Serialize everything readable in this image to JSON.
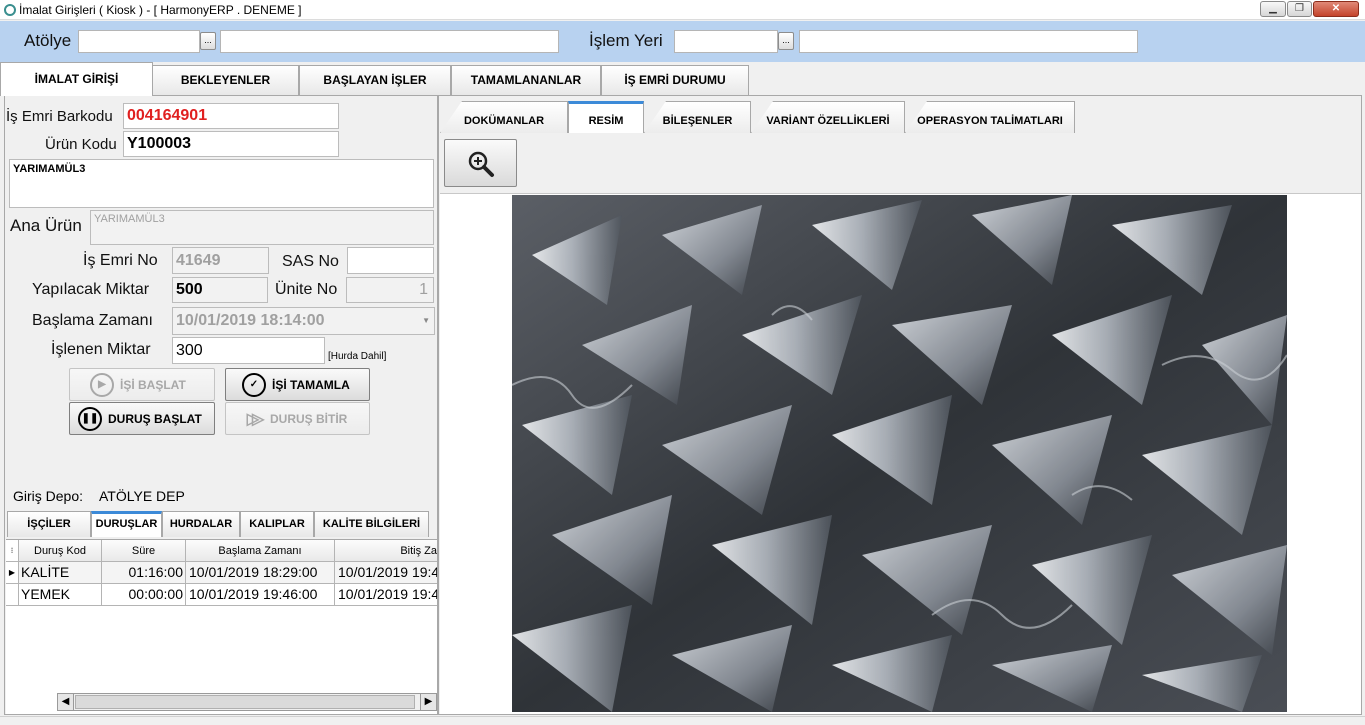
{
  "window": {
    "title": "İmalat Girişleri ( Kiosk ) - [ HarmonyERP . DENEME ]",
    "minimize_icon": "minimize-icon",
    "maximize_icon": "restore-icon",
    "close_icon": "close-icon"
  },
  "filters": {
    "atolye_label": "Atölye",
    "atolye_code": "",
    "atolye_name": "",
    "islem_yeri_label": "İşlem Yeri",
    "islem_yeri_code": "",
    "islem_yeri_name": "",
    "browse_glyph": "..."
  },
  "main_tabs": [
    {
      "label": "İMALAT GİRİŞİ",
      "active": true
    },
    {
      "label": "BEKLEYENLER",
      "active": false
    },
    {
      "label": "BAŞLAYAN İŞLER",
      "active": false
    },
    {
      "label": "TAMAMLANANLAR",
      "active": false
    },
    {
      "label": "İŞ EMRİ DURUMU",
      "active": false
    }
  ],
  "form": {
    "is_emri_barkodu_label": "İş Emri Barkodu",
    "is_emri_barkodu": "004164901",
    "urun_kodu_label": "Ürün Kodu",
    "urun_kodu": "Y100003",
    "urun_aciklama": "YARIMAMÜL3",
    "ana_urun_label": "Ana Ürün",
    "ana_urun": "YARIMAMÜL3",
    "is_emri_no_label": "İş Emri No",
    "is_emri_no": "41649",
    "sas_no_label": "SAS No",
    "sas_no": "",
    "yapilacak_miktar_label": "Yapılacak Miktar",
    "yapilacak_miktar": "500",
    "unite_no_label": "Ünite No",
    "unite_no": "1",
    "baslama_zamani_label": "Başlama Zamanı",
    "baslama_zamani": "10/01/2019 18:14:00",
    "islenen_miktar_label": "İşlenen Miktar",
    "islenen_miktar": "300",
    "hurda_note": "[Hurda Dahil]",
    "highlight_color": "#e02020"
  },
  "actions": {
    "isi_baslat": "İŞİ BAŞLAT",
    "isi_tamamla": "İŞİ TAMAMLA",
    "durus_baslat": "DURUŞ BAŞLAT",
    "durus_bitir": "DURUŞ BİTİR"
  },
  "depo": {
    "label": "Giriş Depo:",
    "value": "ATÖLYE DEP"
  },
  "sub_tabs": [
    {
      "label": "İŞÇİLER",
      "active": false
    },
    {
      "label": "DURUŞLAR",
      "active": true
    },
    {
      "label": "HURDALAR",
      "active": false
    },
    {
      "label": "KALIPLAR",
      "active": false
    },
    {
      "label": "KALİTE BİLGİLERİ",
      "active": false
    }
  ],
  "grid": {
    "columns": [
      "Duruş Kod",
      "Süre",
      "Başlama Zamanı",
      "Bitiş Za"
    ],
    "rows": [
      {
        "cells": [
          "KALİTE",
          "01:16:00",
          "10/01/2019 18:29:00",
          "10/01/2019 19:4"
        ],
        "current": true
      },
      {
        "cells": [
          "YEMEK",
          "00:00:00",
          "10/01/2019 19:46:00",
          "10/01/2019 19:4"
        ],
        "current": false
      }
    ]
  },
  "right_tabs": [
    {
      "label": "DOKÜMANLAR",
      "active": false
    },
    {
      "label": "RESİM",
      "active": true
    },
    {
      "label": "BİLEŞENLER",
      "active": false
    },
    {
      "label": "VARİANT ÖZELLİKLERİ",
      "active": false
    },
    {
      "label": "OPERASYON TALİMATLARI",
      "active": false
    }
  ],
  "image": {
    "subject": "metal-chips-photo",
    "zoom_icon": "zoom-in-icon"
  },
  "colors": {
    "top_bar": "#b8d2f0",
    "active_tab_accent": "#3c8ad8"
  }
}
